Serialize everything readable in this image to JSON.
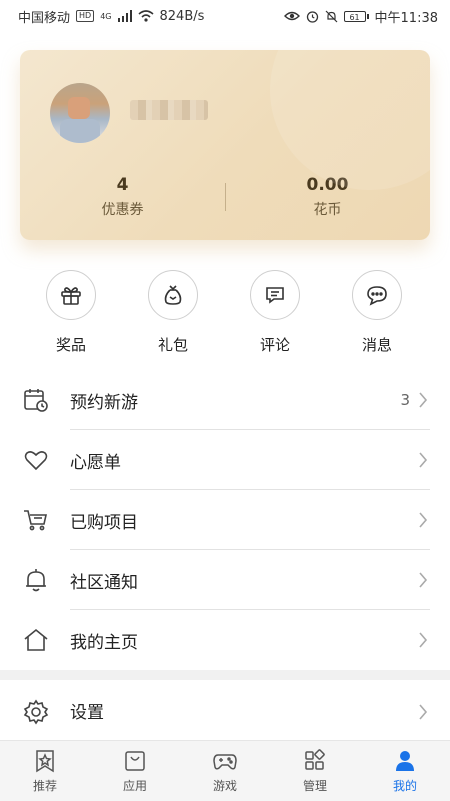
{
  "status_bar": {
    "carrier": "中国移动",
    "hd_badge": "HD",
    "net_type": "4G",
    "speed": "824B/s",
    "battery": "61",
    "time": "中午11:38"
  },
  "profile_card": {
    "coupons": {
      "value": "4",
      "label": "优惠券"
    },
    "flower_coins": {
      "value": "0.00",
      "label": "花币"
    }
  },
  "quick_actions": [
    {
      "label": "奖品",
      "icon": "gift-icon"
    },
    {
      "label": "礼包",
      "icon": "bag-icon"
    },
    {
      "label": "评论",
      "icon": "comment-icon"
    },
    {
      "label": "消息",
      "icon": "message-icon"
    }
  ],
  "menu": [
    {
      "label": "预约新游",
      "count": "3",
      "icon": "calendar-clock-icon"
    },
    {
      "label": "心愿单",
      "count": "",
      "icon": "heart-icon"
    },
    {
      "label": "已购项目",
      "count": "",
      "icon": "cart-icon"
    },
    {
      "label": "社区通知",
      "count": "",
      "icon": "bell-icon"
    },
    {
      "label": "我的主页",
      "count": "",
      "icon": "home-icon"
    }
  ],
  "settings": {
    "label": "设置",
    "icon": "gear-icon"
  },
  "bottom_nav": [
    {
      "label": "推荐",
      "active": false
    },
    {
      "label": "应用",
      "active": false
    },
    {
      "label": "游戏",
      "active": false
    },
    {
      "label": "管理",
      "active": false
    },
    {
      "label": "我的",
      "active": true
    }
  ],
  "colors": {
    "accent": "#1a73e8",
    "card": "#f0dfc0"
  }
}
